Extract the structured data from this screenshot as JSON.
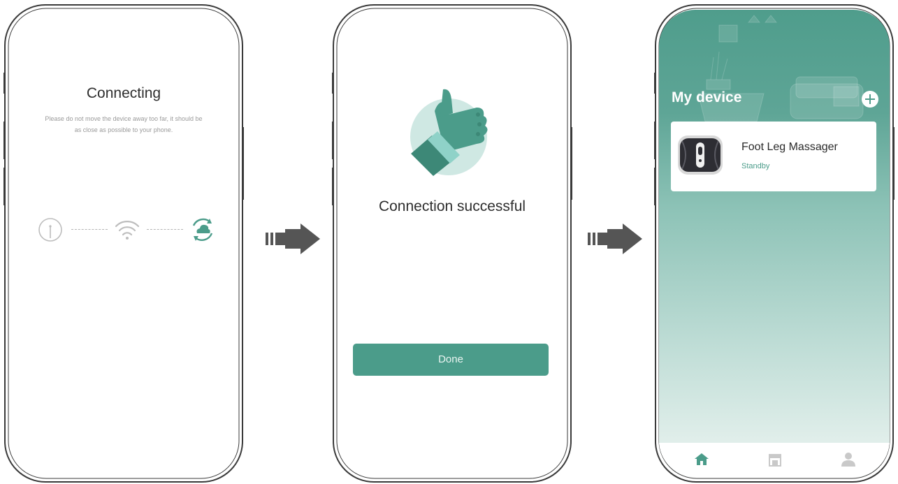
{
  "colors": {
    "accent": "#4b9c8a",
    "text": "#2e2e2e",
    "muted": "#9a9a9a",
    "phone_frame": "#3a3a3a",
    "arrow": "#555555"
  },
  "connecting": {
    "title": "Connecting",
    "description": "Please do not move the device away too far, it should be as close as possible to your phone.",
    "steps": [
      {
        "icon": "device-power-icon"
      },
      {
        "icon": "wifi-icon"
      },
      {
        "icon": "cloud-sync-icon"
      }
    ]
  },
  "success": {
    "title": "Connection successful",
    "illustration": "thumbs-up-icon",
    "done_label": "Done"
  },
  "home": {
    "title": "My device",
    "add_icon": "plus-icon",
    "device": {
      "name": "Foot Leg Massager",
      "status": "Standby",
      "image": "foot-massager-image"
    },
    "tabs": [
      {
        "icon": "home-icon",
        "active": true
      },
      {
        "icon": "store-icon",
        "active": false
      },
      {
        "icon": "profile-icon",
        "active": false
      }
    ]
  }
}
